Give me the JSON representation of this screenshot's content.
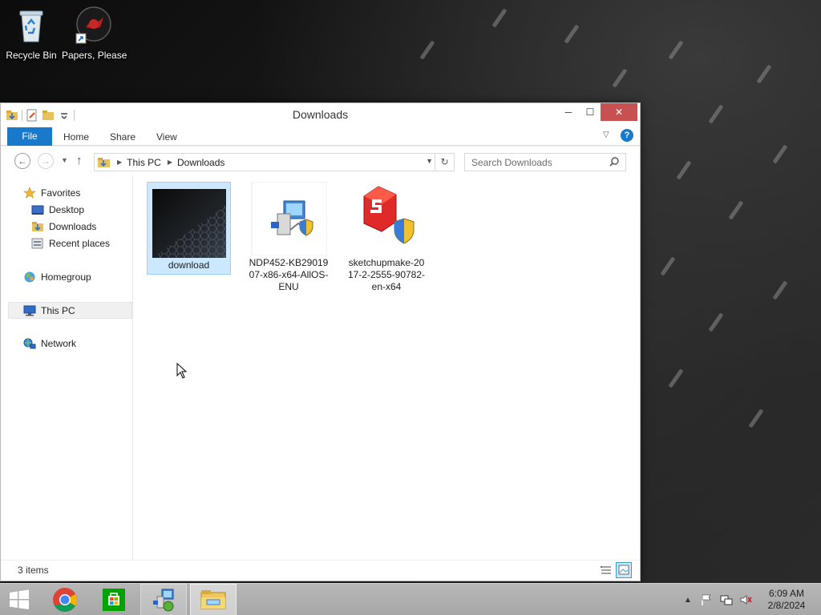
{
  "desktop": {
    "icons": [
      {
        "label": "Recycle Bin",
        "icon": "recycle-bin-icon"
      },
      {
        "label": "Papers, Please",
        "icon": "papers-please-shortcut-icon"
      }
    ]
  },
  "window": {
    "title": "Downloads",
    "controls": {
      "minimize": "─",
      "maximize": "☐",
      "close": "✕"
    }
  },
  "ribbon": {
    "file": "File",
    "tabs": [
      "Home",
      "Share",
      "View"
    ],
    "help": "?"
  },
  "navigation": {
    "breadcrumb": [
      "This PC",
      "Downloads"
    ],
    "search_placeholder": "Search Downloads"
  },
  "nav_pane": {
    "favorites": "Favorites",
    "favorites_items": [
      "Desktop",
      "Downloads",
      "Recent places"
    ],
    "homegroup": "Homegroup",
    "this_pc": "This PC",
    "network": "Network"
  },
  "files": [
    {
      "name": "download",
      "type": "image",
      "selected": true
    },
    {
      "name": "NDP452-KB2901907-x86-x64-AllOS-ENU",
      "type": "installer",
      "selected": false
    },
    {
      "name": "sketchupmake-2017-2-2555-90782-en-x64",
      "type": "installer",
      "selected": false
    }
  ],
  "status": {
    "items_count": "3 items"
  },
  "taskbar": {
    "clock_time": "6:09 AM",
    "clock_date": "2/8/2024",
    "pinned": [
      "chrome-icon",
      "store-icon",
      "installer-icon",
      "file-explorer-icon"
    ]
  },
  "colors": {
    "accent": "#1979ca",
    "close_button": "#c75050",
    "selection": "#cce8ff",
    "taskbar": "#adadad"
  }
}
